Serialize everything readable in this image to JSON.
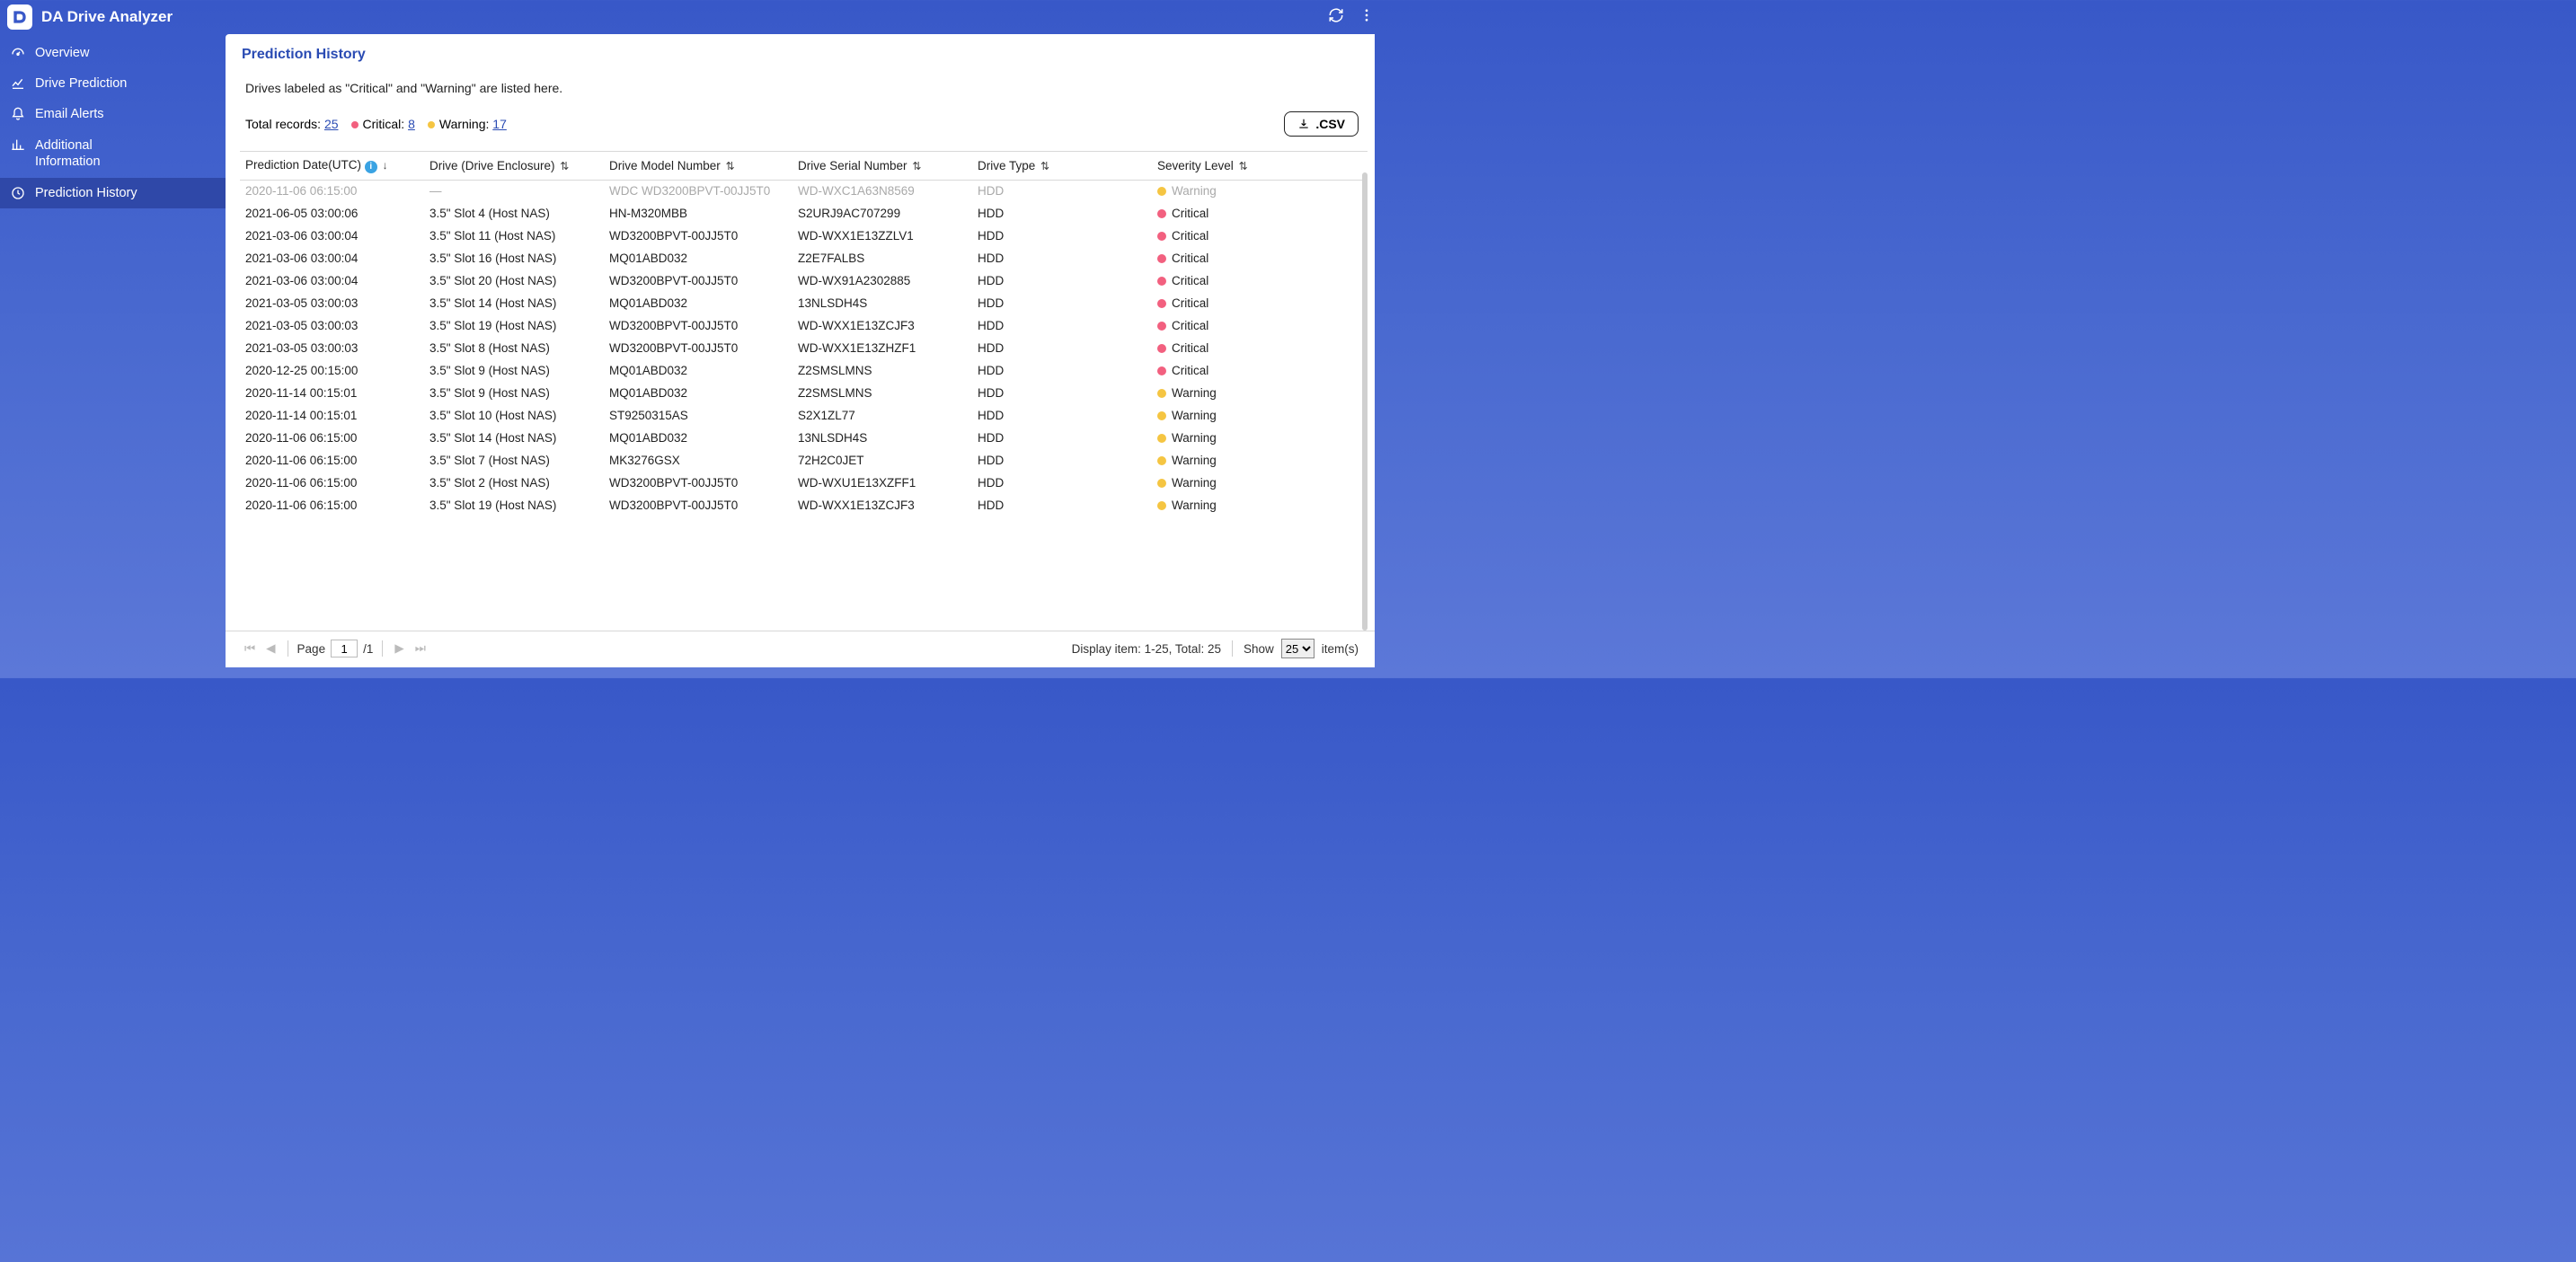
{
  "app": {
    "title": "DA Drive Analyzer"
  },
  "topbar": {
    "refresh": "refresh",
    "more": "more"
  },
  "sidebar": {
    "items": [
      {
        "label": "Overview"
      },
      {
        "label": "Drive Prediction"
      },
      {
        "label": "Email Alerts"
      },
      {
        "label": "Additional Information"
      },
      {
        "label": "Prediction History"
      }
    ]
  },
  "page": {
    "title": "Prediction History",
    "description": "Drives labeled as \"Critical\" and \"Warning\" are listed here.",
    "stats": {
      "total_label": "Total records:",
      "total_value": "25",
      "critical_label": "Critical:",
      "critical_value": "8",
      "warning_label": "Warning:",
      "warning_value": "17"
    },
    "csv_label": ".CSV"
  },
  "table": {
    "headers": [
      "Prediction Date(UTC)",
      "Drive (Drive Enclosure)",
      "Drive Model Number",
      "Drive Serial Number",
      "Drive Type",
      "Severity Level"
    ],
    "rows": [
      {
        "date": "2020-11-06 06:15:00",
        "enclosure": "—",
        "model": "WDC WD3200BPVT-00JJ5T0",
        "serial": "WD-WXC1A63N8569",
        "type": "HDD",
        "severity": "Warning",
        "dim": true
      },
      {
        "date": "2021-06-05 03:00:06",
        "enclosure": "3.5\" Slot 4 (Host NAS)",
        "model": "HN-M320MBB",
        "serial": "S2URJ9AC707299",
        "type": "HDD",
        "severity": "Critical"
      },
      {
        "date": "2021-03-06 03:00:04",
        "enclosure": "3.5\" Slot 11 (Host NAS)",
        "model": "WD3200BPVT-00JJ5T0",
        "serial": "WD-WXX1E13ZZLV1",
        "type": "HDD",
        "severity": "Critical"
      },
      {
        "date": "2021-03-06 03:00:04",
        "enclosure": "3.5\" Slot 16 (Host NAS)",
        "model": "MQ01ABD032",
        "serial": "Z2E7FALBS",
        "type": "HDD",
        "severity": "Critical"
      },
      {
        "date": "2021-03-06 03:00:04",
        "enclosure": "3.5\" Slot 20 (Host NAS)",
        "model": "WD3200BPVT-00JJ5T0",
        "serial": "WD-WX91A2302885",
        "type": "HDD",
        "severity": "Critical"
      },
      {
        "date": "2021-03-05 03:00:03",
        "enclosure": "3.5\" Slot 14 (Host NAS)",
        "model": "MQ01ABD032",
        "serial": "13NLSDH4S",
        "type": "HDD",
        "severity": "Critical"
      },
      {
        "date": "2021-03-05 03:00:03",
        "enclosure": "3.5\" Slot 19 (Host NAS)",
        "model": "WD3200BPVT-00JJ5T0",
        "serial": "WD-WXX1E13ZCJF3",
        "type": "HDD",
        "severity": "Critical"
      },
      {
        "date": "2021-03-05 03:00:03",
        "enclosure": "3.5\" Slot 8 (Host NAS)",
        "model": "WD3200BPVT-00JJ5T0",
        "serial": "WD-WXX1E13ZHZF1",
        "type": "HDD",
        "severity": "Critical"
      },
      {
        "date": "2020-12-25 00:15:00",
        "enclosure": "3.5\" Slot 9 (Host NAS)",
        "model": "MQ01ABD032",
        "serial": "Z2SMSLMNS",
        "type": "HDD",
        "severity": "Critical"
      },
      {
        "date": "2020-11-14 00:15:01",
        "enclosure": "3.5\" Slot 9 (Host NAS)",
        "model": "MQ01ABD032",
        "serial": "Z2SMSLMNS",
        "type": "HDD",
        "severity": "Warning"
      },
      {
        "date": "2020-11-14 00:15:01",
        "enclosure": "3.5\" Slot 10 (Host NAS)",
        "model": "ST9250315AS",
        "serial": "S2X1ZL77",
        "type": "HDD",
        "severity": "Warning"
      },
      {
        "date": "2020-11-06 06:15:00",
        "enclosure": "3.5\" Slot 14 (Host NAS)",
        "model": "MQ01ABD032",
        "serial": "13NLSDH4S",
        "type": "HDD",
        "severity": "Warning"
      },
      {
        "date": "2020-11-06 06:15:00",
        "enclosure": "3.5\" Slot 7 (Host NAS)",
        "model": "MK3276GSX",
        "serial": "72H2C0JET",
        "type": "HDD",
        "severity": "Warning"
      },
      {
        "date": "2020-11-06 06:15:00",
        "enclosure": "3.5\" Slot 2 (Host NAS)",
        "model": "WD3200BPVT-00JJ5T0",
        "serial": "WD-WXU1E13XZFF1",
        "type": "HDD",
        "severity": "Warning"
      },
      {
        "date": "2020-11-06 06:15:00",
        "enclosure": "3.5\" Slot 19 (Host NAS)",
        "model": "WD3200BPVT-00JJ5T0",
        "serial": "WD-WXX1E13ZCJF3",
        "type": "HDD",
        "severity": "Warning"
      }
    ]
  },
  "pager": {
    "page_label": "Page",
    "page_value": "1",
    "page_total": "/1"
  },
  "footer": {
    "display_label": "Display item: 1-25,  Total: 25",
    "show_label": "Show",
    "show_value": "25",
    "items_label": "item(s)"
  }
}
